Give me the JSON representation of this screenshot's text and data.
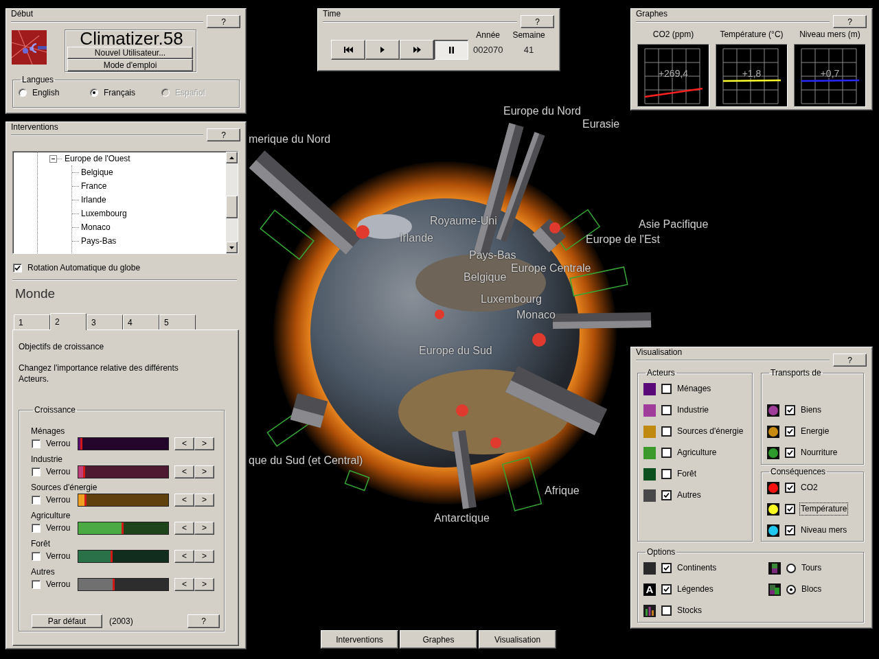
{
  "start_panel": {
    "title": "Début",
    "help_button": "?",
    "app_name": "Climatizer.58",
    "buttons": [
      "Nouvel Utilisateur...",
      "Mode d'emploi"
    ],
    "languages": {
      "title": "Langues",
      "options": [
        {
          "label": "English",
          "selected": false,
          "disabled": false
        },
        {
          "label": "Français",
          "selected": true,
          "disabled": false
        },
        {
          "label": "Español",
          "selected": false,
          "disabled": true
        }
      ]
    }
  },
  "time_panel": {
    "title": "Time",
    "help_button": "?",
    "controls": [
      {
        "kind": "skip-back",
        "selected": false
      },
      {
        "kind": "play",
        "selected": false
      },
      {
        "kind": "fast-forward",
        "selected": false
      },
      {
        "kind": "pause",
        "selected": true
      }
    ],
    "fields": [
      {
        "label": "Année",
        "value": "002070"
      },
      {
        "label": "Semaine",
        "value": "41"
      }
    ]
  },
  "graphs_panel": {
    "title": "Graphes",
    "help_button": "?",
    "graphs": [
      {
        "label": "CO2 (ppm)",
        "value": "+269,4",
        "color": "#ff2020",
        "kind": "rising"
      },
      {
        "label": "Température (°C)",
        "value": "+1,8",
        "color": "#ffff30",
        "kind": "flat"
      },
      {
        "label": "Niveau mers (m)",
        "value": "+0,7",
        "color": "#2828ff",
        "kind": "flat"
      }
    ]
  },
  "interventions_panel": {
    "title": "Interventions",
    "help_button": "?",
    "tree": [
      {
        "label": "Europe de l'Ouest",
        "expanded": true,
        "children": [
          {
            "label": "Belgique"
          },
          {
            "label": "France"
          },
          {
            "label": "Irlande"
          },
          {
            "label": "Luxembourg"
          },
          {
            "label": "Monaco"
          },
          {
            "label": "Pays-Bas"
          }
        ]
      }
    ],
    "auto_rotate": {
      "label": "Rotation Automatique du globe",
      "checked": true
    },
    "region": "Monde",
    "tabs": [
      {
        "label": "1",
        "selected": false
      },
      {
        "label": "2",
        "selected": true
      },
      {
        "label": "3",
        "selected": false
      },
      {
        "label": "4",
        "selected": false
      },
      {
        "label": "5",
        "selected": false
      }
    ],
    "heading": "Objectifs de croissance",
    "description": "Changez l'importance relative des différents Acteurs.",
    "growth": {
      "title": "Croissance",
      "rows": [
        {
          "name": "Ménages",
          "lock_label": "Verrou",
          "locked": false,
          "level": 0.02,
          "color": "#5a1070",
          "buttons": [
            "<",
            ">"
          ]
        },
        {
          "name": "Industrie",
          "lock_label": "Verrou",
          "locked": false,
          "level": 0.05,
          "color": "#c0407a",
          "buttons": [
            "<",
            ">"
          ]
        },
        {
          "name": "Sources d'énergie",
          "lock_label": "Verrou",
          "locked": false,
          "level": 0.07,
          "color": "#f0a020",
          "buttons": [
            "<",
            ">"
          ]
        },
        {
          "name": "Agriculture",
          "lock_label": "Verrou",
          "locked": false,
          "level": 0.48,
          "color": "#4caa44",
          "buttons": [
            "<",
            ">"
          ]
        },
        {
          "name": "Forêt",
          "lock_label": "Verrou",
          "locked": false,
          "level": 0.36,
          "color": "#2a7048",
          "buttons": [
            "<",
            ">"
          ]
        },
        {
          "name": "Autres",
          "lock_label": "Verrou",
          "locked": false,
          "level": 0.38,
          "color": "#707070",
          "buttons": [
            "<",
            ">"
          ]
        }
      ],
      "default_button": "Par défaut",
      "year": "(2003)",
      "help_button": "?"
    }
  },
  "globe_view": {
    "labels": [
      "Europe du Nord",
      "Eurasie",
      "merique du Nord",
      "Royaume-Uni",
      "Irlande",
      "Europe de l'Est",
      "Asie Pacifique",
      "Pays-Bas",
      "Europe Centrale",
      "Belgique",
      "Luxembourg",
      "Monaco",
      "Europe du Sud",
      "que du Sud (et Central)",
      "Afrique",
      "Antarctique"
    ]
  },
  "visualisation_panel": {
    "title": "Visualisation",
    "help_button": "?",
    "actors": {
      "title": "Acteurs",
      "items": [
        {
          "label": "Ménages",
          "color": "#5a0a78",
          "checked": false
        },
        {
          "label": "Industrie",
          "color": "#a03c9a",
          "checked": false
        },
        {
          "label": "Sources d'énergie",
          "color": "#c08a10",
          "checked": false
        },
        {
          "label": "Agriculture",
          "color": "#3c9a2c",
          "checked": false
        },
        {
          "label": "Forêt",
          "color": "#0c5020",
          "checked": false
        },
        {
          "label": "Autres",
          "color": "#484848",
          "checked": true
        }
      ]
    },
    "transports": {
      "title": "Transports de",
      "items": [
        {
          "label": "Biens",
          "color": "#a03c9a",
          "checked": true
        },
        {
          "label": "Energie",
          "color": "#c88a10",
          "checked": true
        },
        {
          "label": "Nourriture",
          "color": "#2e9a2e",
          "checked": true
        }
      ]
    },
    "consequences": {
      "title": "Conséquences",
      "items": [
        {
          "label": "CO2",
          "color": "#ff1010",
          "checked": true,
          "focused": false
        },
        {
          "label": "Température",
          "color": "#ffff20",
          "checked": true,
          "focused": true
        },
        {
          "label": "Niveau mers",
          "color": "#20c8f0",
          "checked": true,
          "focused": false
        }
      ]
    },
    "options": {
      "title": "Options",
      "items": [
        {
          "kind": "check",
          "label": "Continents",
          "checked": true
        },
        {
          "kind": "check",
          "icon_glyph": "A",
          "label": "Légendes",
          "checked": true
        },
        {
          "kind": "check",
          "label": "Stocks",
          "checked": false
        },
        {
          "kind": "radio",
          "label": "Tours",
          "selected": false
        },
        {
          "kind": "radio",
          "label": "Blocs",
          "selected": true
        }
      ]
    }
  },
  "bottom_bar": {
    "buttons": [
      "Interventions",
      "Graphes",
      "Visualisation"
    ]
  }
}
